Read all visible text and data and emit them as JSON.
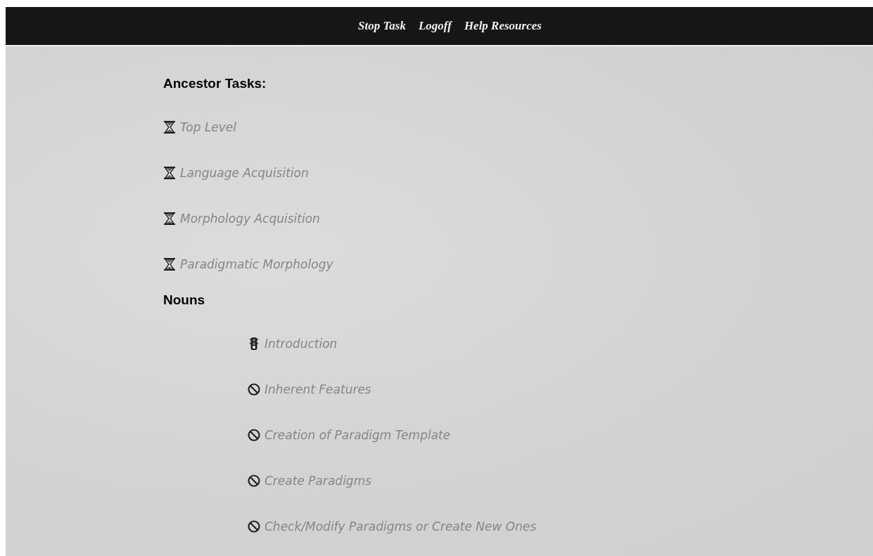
{
  "top_bar": {
    "links": [
      "Stop Task",
      "Logoff",
      "Help Resources"
    ]
  },
  "sections": [
    {
      "heading": "Ancestor Tasks:",
      "indented": false,
      "items": [
        {
          "label": "Top Level",
          "kind": "hourglass"
        },
        {
          "label": "Language Acquisition",
          "kind": "hourglass"
        },
        {
          "label": "Morphology Acquisition",
          "kind": "hourglass"
        },
        {
          "label": "Paradigmatic Morphology",
          "kind": "hourglass"
        }
      ]
    },
    {
      "heading": "Nouns",
      "indented": true,
      "items": [
        {
          "label": "Introduction",
          "kind": "traffic-light"
        },
        {
          "label": "Inherent Features",
          "kind": "blocked"
        },
        {
          "label": "Creation of Paradigm Template",
          "kind": "blocked"
        },
        {
          "label": "Create Paradigms",
          "kind": "blocked"
        },
        {
          "label": "Check/Modify Paradigms or Create New Ones",
          "kind": "blocked"
        }
      ]
    }
  ]
}
